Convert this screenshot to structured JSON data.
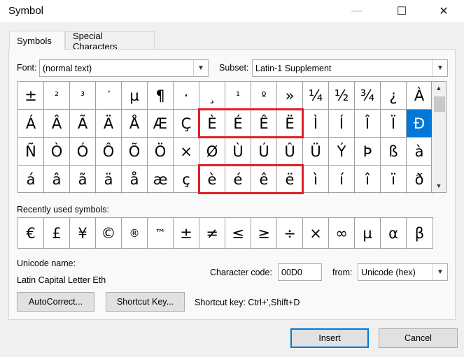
{
  "window": {
    "title": "Symbol",
    "minimize": "—",
    "maximize": "☐",
    "close": "✕"
  },
  "tabs": [
    {
      "label": "Symbols"
    },
    {
      "label": "Special Characters"
    }
  ],
  "font": {
    "label": "Font:",
    "value": "(normal text)"
  },
  "subset": {
    "label": "Subset:",
    "value": "Latin-1 Supplement"
  },
  "grid": {
    "rows": [
      [
        "±",
        "²",
        "³",
        "´",
        "µ",
        "¶",
        "·",
        "¸",
        "¹",
        "º",
        "»",
        "¼",
        "½",
        "¾",
        "¿",
        "À"
      ],
      [
        "Á",
        "Â",
        "Ã",
        "Ä",
        "Å",
        "Æ",
        "Ç",
        "È",
        "É",
        "Ê",
        "Ë",
        "Ì",
        "Í",
        "Î",
        "Ï",
        "Đ"
      ],
      [
        "Ñ",
        "Ò",
        "Ó",
        "Ô",
        "Õ",
        "Ö",
        "×",
        "Ø",
        "Ù",
        "Ú",
        "Û",
        "Ü",
        "Ý",
        "Þ",
        "ß",
        "à"
      ],
      [
        "á",
        "â",
        "ã",
        "ä",
        "å",
        "æ",
        "ç",
        "è",
        "é",
        "ê",
        "ë",
        "ì",
        "í",
        "î",
        "ï",
        "ð"
      ]
    ],
    "selected": {
      "row": 1,
      "col": 15
    },
    "highlights": [
      {
        "row": 1,
        "from_col": 7,
        "to_col": 10
      },
      {
        "row": 3,
        "from_col": 7,
        "to_col": 10
      }
    ]
  },
  "recent": {
    "label": "Recently used symbols:",
    "symbols": [
      "€",
      "£",
      "¥",
      "©",
      "®",
      "™",
      "±",
      "≠",
      "≤",
      "≥",
      "÷",
      "×",
      "∞",
      "µ",
      "α",
      "β"
    ]
  },
  "unicode_name": {
    "label": "Unicode name:",
    "value": "Latin Capital Letter Eth"
  },
  "char_code": {
    "label": "Character code:",
    "value": "00D0"
  },
  "from": {
    "label": "from:",
    "value": "Unicode (hex)"
  },
  "buttons": {
    "autocorrect": "AutoCorrect...",
    "shortcut_key": "Shortcut Key...",
    "insert": "Insert",
    "cancel": "Cancel"
  },
  "shortcut_text": "Shortcut key: Ctrl+',Shift+D",
  "colors": {
    "selection": "#0078d7",
    "highlight": "#e0202a"
  }
}
